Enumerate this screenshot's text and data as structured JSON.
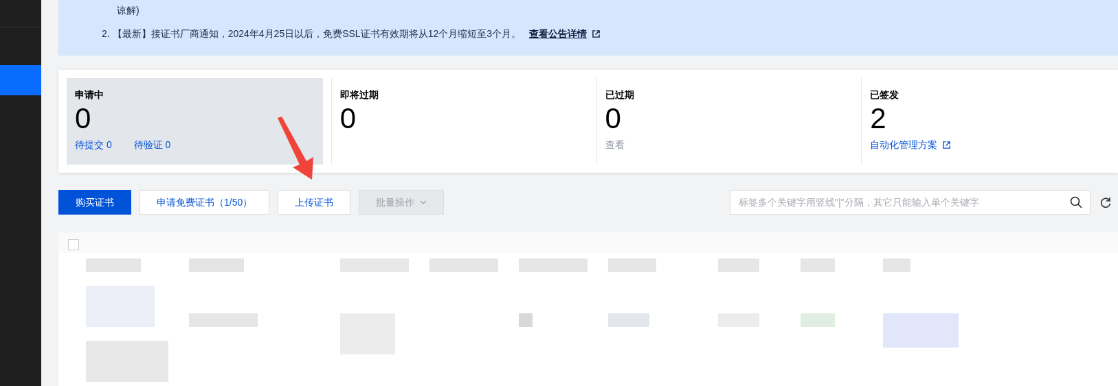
{
  "notice": {
    "continuation": "谅解)",
    "items": [
      {
        "number": "2.",
        "text": "【最新】接证书厂商通知，2024年4月25日以后，免费SSL证书有效期将从12个月缩短至3个月。",
        "link": "查看公告详情"
      }
    ]
  },
  "stats": [
    {
      "label": "申请中",
      "value": "0",
      "selected": true,
      "links": [
        {
          "text": "待提交 0"
        },
        {
          "text": "待验证 0"
        }
      ]
    },
    {
      "label": "即将过期",
      "value": "0",
      "selected": false
    },
    {
      "label": "已过期",
      "value": "0",
      "selected": false,
      "note": "查看"
    },
    {
      "label": "已签发",
      "value": "2",
      "selected": false,
      "links": [
        {
          "text": "自动化管理方案",
          "external": true
        }
      ]
    }
  ],
  "toolbar": {
    "buttons": [
      {
        "label": "购买证书",
        "kind": "primary"
      },
      {
        "label": "申请免费证书（1/50）",
        "kind": "outline"
      },
      {
        "label": "上传证书",
        "kind": "outline"
      },
      {
        "label": "批量操作",
        "kind": "disabled"
      }
    ],
    "search": {
      "placeholder": "标签多个关键字用竖线\"|\"分隔，其它只能输入单个关键字"
    }
  },
  "table": {
    "select_all": {
      "checked": false
    }
  }
}
